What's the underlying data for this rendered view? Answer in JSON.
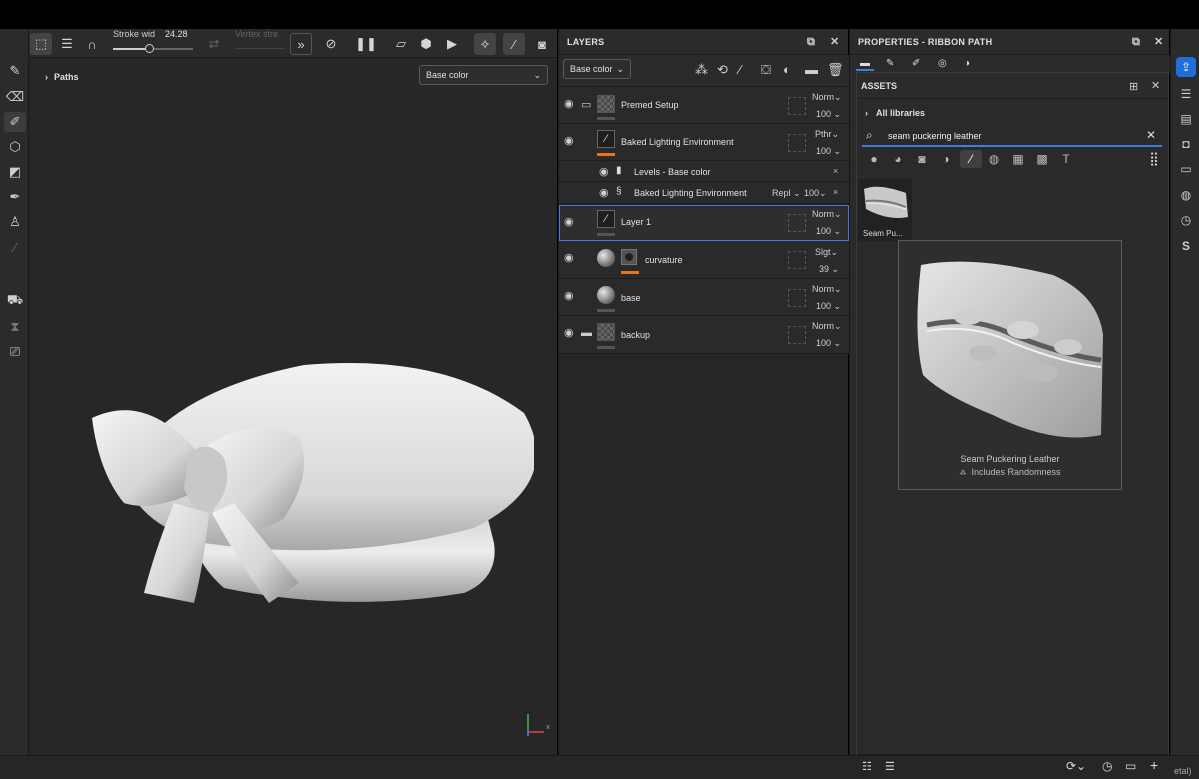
{
  "toolbar": {
    "stroke_width_label": "Stroke wid",
    "stroke_width_value": "24.28",
    "stroke_width_slider": 0.3,
    "vertex_strength_label": "Vertex stre"
  },
  "viewport": {
    "paths_label": "Paths",
    "channel_dropdown": "Base color"
  },
  "layers": {
    "title": "LAYERS",
    "channel_dropdown": "Base color",
    "rows": [
      {
        "name": "Premed Setup",
        "blend": "Norm",
        "opacity": "100"
      },
      {
        "name": "Baked Lighting Environment",
        "blend": "Pthr",
        "opacity": "100"
      },
      {
        "name": "Levels - Base color"
      },
      {
        "name": "Baked Lighting Environment",
        "blend": "Repl",
        "opacity": "100"
      },
      {
        "name": "Layer 1",
        "blend": "Norm",
        "opacity": "100"
      },
      {
        "name": "curvature",
        "blend": "Slgt",
        "opacity": "39"
      },
      {
        "name": "base",
        "blend": "Norm",
        "opacity": "100"
      },
      {
        "name": "backup",
        "blend": "Norm",
        "opacity": "100"
      }
    ]
  },
  "properties": {
    "title": "PROPERTIES - RIBBON PATH"
  },
  "assets": {
    "title": "ASSETS",
    "libraries_label": "All libraries",
    "search_value": "seam puckering leather",
    "result_label": "Seam Pu...",
    "preview_title": "Seam Puckering Leather",
    "preview_subtitle": "Includes Randomness"
  },
  "status": {
    "right_text": "etal)"
  },
  "colors": {
    "accent": "#3f7be0",
    "orange": "#e8741c",
    "highlight_icon": "#1e6fd9"
  }
}
